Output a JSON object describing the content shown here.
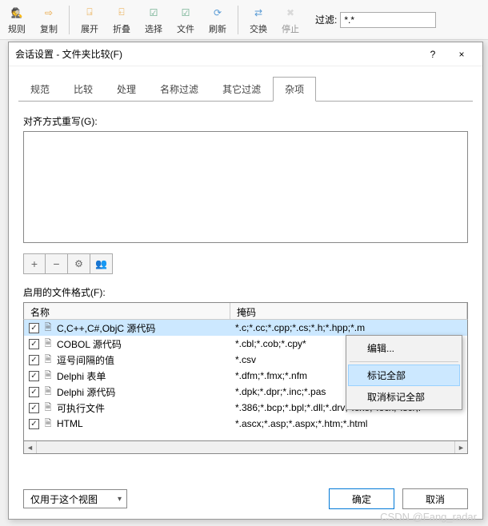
{
  "toolbar": {
    "buttons": [
      "规则",
      "复制",
      "展开",
      "折叠",
      "选择",
      "文件",
      "刷新",
      "交换",
      "停止"
    ],
    "filter_label": "过滤:",
    "filter_value": "*.*"
  },
  "dialog": {
    "title": "会话设置 - 文件夹比较(F)",
    "help": "?",
    "close": "×",
    "tabs": [
      "规范",
      "比较",
      "处理",
      "名称过滤",
      "其它过滤",
      "杂项"
    ],
    "active_tab": 5,
    "align_label": "对齐方式重写(G):",
    "align_text": "",
    "mini": {
      "add": "+",
      "remove": "−",
      "gear": "⚙",
      "group": "👥"
    },
    "formats_label": "启用的文件格式(F):",
    "columns": {
      "name": "名称",
      "mask": "掩码"
    },
    "rows": [
      {
        "checked": true,
        "name": "C,C++,C#,ObjC 源代码",
        "mask": "*.c;*.cc;*.cpp;*.cs;*.h;*.hpp;*.m",
        "selected": true
      },
      {
        "checked": true,
        "name": "COBOL 源代码",
        "mask": "*.cbl;*.cob;*.cpy*"
      },
      {
        "checked": true,
        "name": "逗号间隔的值",
        "mask": "*.csv"
      },
      {
        "checked": true,
        "name": "Delphi 表单",
        "mask": "*.dfm;*.fmx;*.nfm"
      },
      {
        "checked": true,
        "name": "Delphi 源代码",
        "mask": "*.dpk;*.dpr;*.inc;*.pas"
      },
      {
        "checked": true,
        "name": "可执行文件",
        "mask": "*.386;*.bcp;*.bpl;*.dll;*.drv;*.exe;*.ocx;*.scr;."
      },
      {
        "checked": true,
        "name": "HTML",
        "mask": "*.ascx;*.asp;*.aspx;*.htm;*.html"
      }
    ],
    "context_menu": {
      "edit": "编辑...",
      "mark_all": "标记全部",
      "unmark_all": "取消标记全部"
    },
    "scope_label": "仅用于这个视图",
    "ok": "确定",
    "cancel": "取消"
  },
  "watermark": "CSDN @Fang_radar"
}
